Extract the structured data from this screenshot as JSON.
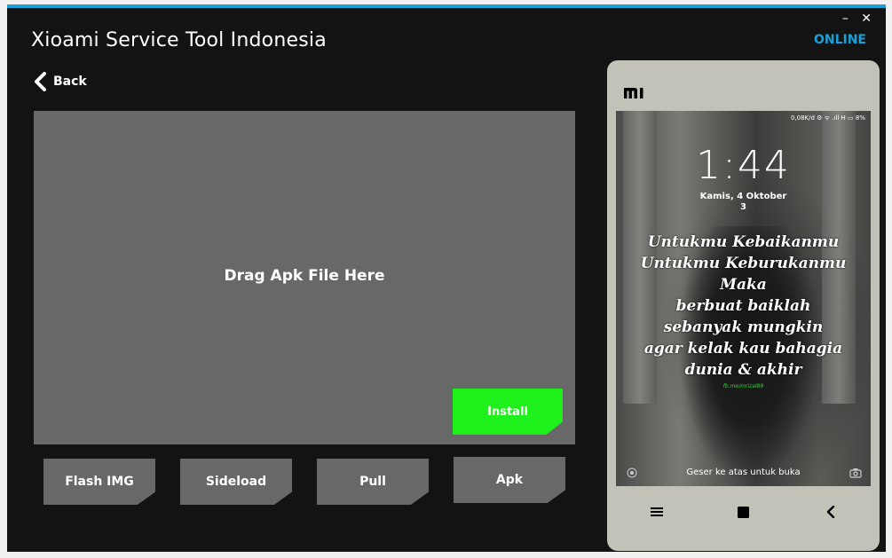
{
  "app": {
    "title": "Xioami Service Tool Indonesia",
    "status": "ONLINE",
    "minimize": "–",
    "close": "✕"
  },
  "nav": {
    "back_label": "Back"
  },
  "dropzone": {
    "label": "Drag Apk File Here",
    "install_label": "Install"
  },
  "tools": [
    "Flash IMG",
    "Sideload",
    "Pull",
    "Apk"
  ],
  "phone": {
    "brand": "mi",
    "statusbar": "0,08K/d ⚙ ᯤ .ıll H ▭ 8%",
    "time": "1:44",
    "date": "Kamis, 4 Oktober",
    "date_line2": "3",
    "quote": [
      "Untukmu Kebaikanmu",
      "Untukmu Keburukanmu",
      "Maka",
      "berbuat baiklah",
      "sebanyak mungkin",
      "agar kelak kau bahagia",
      "dunia & akhir"
    ],
    "credit": "fb.me/mrizal89",
    "swipe": "Geser ke atas untuk buka"
  },
  "colors": {
    "accent": "#19a1d9",
    "install": "#1ef01b",
    "panel": "#686868",
    "background": "#131313"
  }
}
